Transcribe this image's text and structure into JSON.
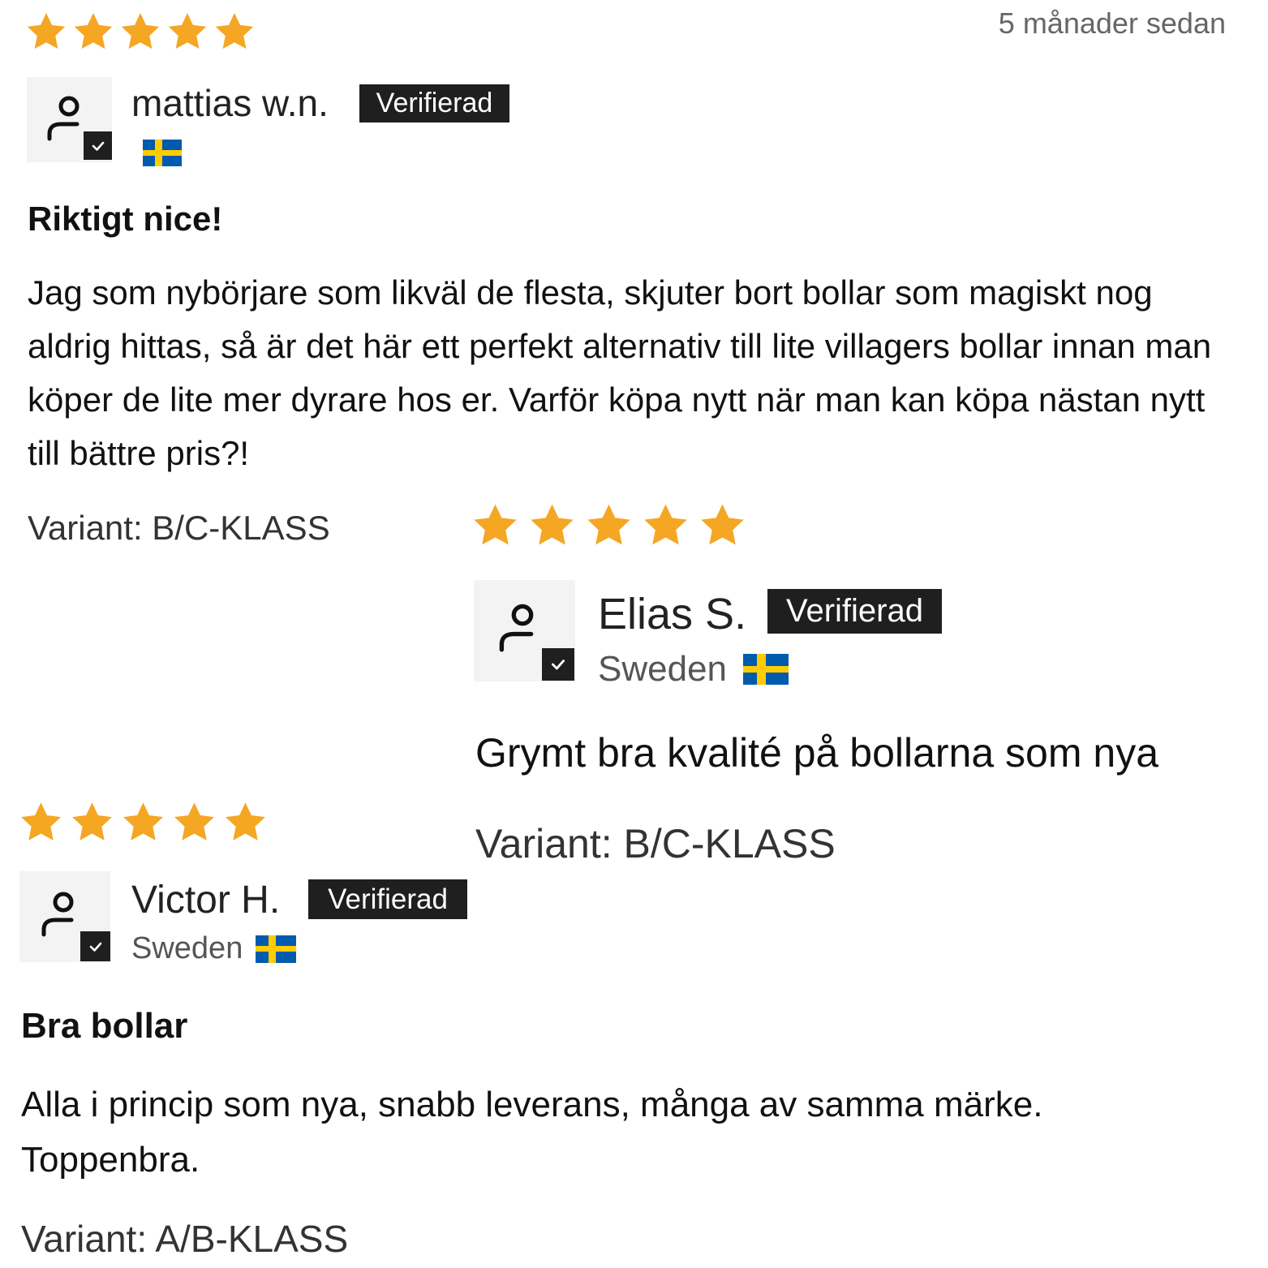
{
  "colors": {
    "star": "#F5A623",
    "badge_bg": "#1f1f1f",
    "flag_blue": "#005BAC",
    "flag_yellow": "#FECC02"
  },
  "reviews": [
    {
      "rating": 5,
      "date": "5 månader sedan",
      "name": "mattias w.n.",
      "badge": "Verifierad",
      "location": "",
      "flag_icon": "sweden-flag-icon",
      "title": "Riktigt nice!",
      "body": "Jag som nybörjare som likväl de flesta, skjuter bort bollar som magiskt nog aldrig hittas, så är det här ett perfekt alternativ till lite villagers bollar innan man köper de lite mer dyrare hos er. Varför köpa nytt när man kan köpa nästan nytt till bättre pris?!",
      "variant": "Variant: B/C-KLASS"
    },
    {
      "rating": 5,
      "name": "Elias S.",
      "badge": "Verifierad",
      "location": "Sweden",
      "flag_icon": "sweden-flag-icon",
      "title": "Grymt bra kvalité på bollarna som nya",
      "variant": "Variant: B/C-KLASS"
    },
    {
      "rating": 5,
      "name": "Victor H.",
      "badge": "Verifierad",
      "location": "Sweden",
      "flag_icon": "sweden-flag-icon",
      "title": "Bra bollar",
      "body": "Alla i princip som nya, snabb leverans, många av samma märke. Toppenbra.",
      "variant": "Variant: A/B-KLASS"
    }
  ]
}
